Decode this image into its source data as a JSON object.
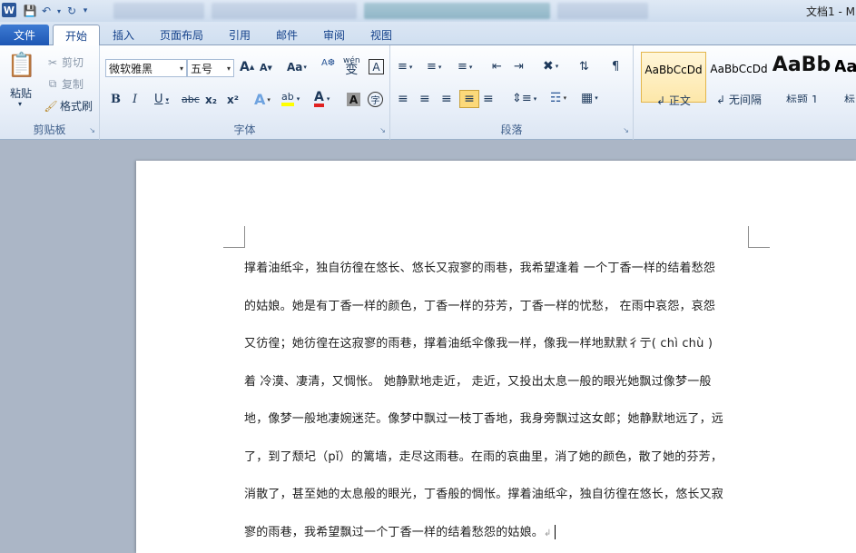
{
  "titlebar": {
    "doc_title": "文档1 - M"
  },
  "tabs": {
    "file": "文件",
    "home": "开始",
    "insert": "插入",
    "layout": "页面布局",
    "references": "引用",
    "mailings": "邮件",
    "review": "审阅",
    "view": "视图"
  },
  "clipboard": {
    "paste": "粘贴",
    "cut": "剪切",
    "copy": "复制",
    "format_painter": "格式刷",
    "label": "剪贴板"
  },
  "font": {
    "name": "微软雅黑",
    "size": "五号",
    "grow": "A",
    "shrink": "A",
    "case": "Aa",
    "label": "字体",
    "bold": "B",
    "italic": "I",
    "underline": "U",
    "strike": "abc",
    "subscript": "x₂",
    "superscript": "x²",
    "effects": "A",
    "highlight": "ab",
    "color": "A",
    "shading": "A",
    "enclose": "字",
    "phonetic": "wén",
    "phonetic_char": "变",
    "border": "A"
  },
  "paragraph": {
    "label": "段落"
  },
  "styles": [
    {
      "sample": "AaBbCcDd",
      "name": "正文",
      "selected": true
    },
    {
      "sample": "AaBbCcDd",
      "name": "无间隔",
      "selected": false
    },
    {
      "sample": "AaBb",
      "name": "标题 1",
      "selected": false
    },
    {
      "sample": "Aa",
      "name": "标",
      "selected": false
    }
  ],
  "document": {
    "lines": [
      "撑着油纸伞，独自彷徨在悠长、悠长又寂寥的雨巷，我希望逢着 一个丁香一样的结着愁怨",
      "的姑娘。她是有丁香一样的颜色，丁香一样的芬芳，丁香一样的忧愁， 在雨中哀怨，哀怨",
      "又彷徨；她彷徨在这寂寥的雨巷，撑着油纸伞像我一样，像我一样地默默彳亍(  chì chù  )",
      "着  冷漠、凄清，又惆怅。  她静默地走近，  走近，又投出太息一般的眼光她飘过像梦一般",
      "地，像梦一般地凄婉迷茫。像梦中飘过一枝丁香地，我身旁飘过这女郎；她静默地远了，远",
      "了，到了颓圮（pǐ）的篱墙，走尽这雨巷。在雨的哀曲里，消了她的颜色，散了她的芬芳，",
      "消散了，甚至她的太息般的眼光，丁香般的惆怅。撑着油纸伞，独自彷徨在悠长，悠长又寂",
      "寥的雨巷，我希望飘过一个丁香一样的结着愁怨的姑娘。"
    ]
  }
}
